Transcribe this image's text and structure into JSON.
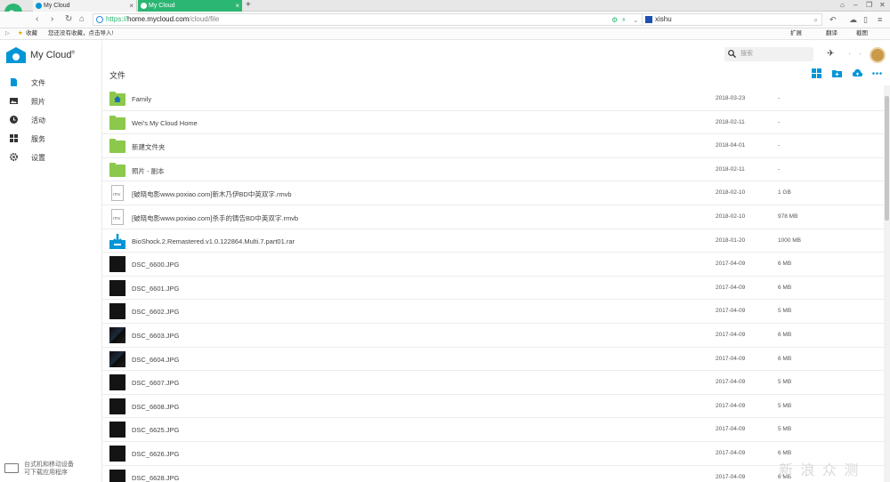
{
  "browser": {
    "tabs": [
      {
        "label": "My Cloud",
        "close": "×"
      },
      {
        "label": "My Cloud",
        "close": "×"
      }
    ],
    "new_tab": "+",
    "url": {
      "scheme": "https://",
      "host": "home.mycloud.com",
      "path": "/cloud/file"
    },
    "search_value": "xishu",
    "favorites": {
      "label": "收藏",
      "hint": "您还没有收藏，点击导入!",
      "ext": "扩展",
      "trans": "翻译",
      "shot": "截图"
    }
  },
  "app": {
    "title": "My Cloud",
    "title_mark": "®",
    "search_placeholder": "搜索",
    "sidebar": [
      {
        "label": "文件",
        "icon": "file-icon"
      },
      {
        "label": "照片",
        "icon": "photo-icon"
      },
      {
        "label": "活动",
        "icon": "clock-icon"
      },
      {
        "label": "服务",
        "icon": "grid-icon"
      },
      {
        "label": "设置",
        "icon": "gear-icon"
      }
    ],
    "device_note": [
      "台式机和移动设备",
      "可下载应用程序"
    ],
    "main_title": "文件",
    "colors": {
      "accent": "#0096d6",
      "folder": "#8cc84b",
      "tab_active": "#2bb673"
    }
  },
  "files": [
    {
      "name": "Family",
      "date": "2018-03-23",
      "size": "-",
      "kind": "shared-folder"
    },
    {
      "name": "Wei's My Cloud Home",
      "date": "2018-02-11",
      "size": "-",
      "kind": "folder"
    },
    {
      "name": "新建文件夹",
      "date": "2018-04-01",
      "size": "-",
      "kind": "folder"
    },
    {
      "name": "照片 - 副本",
      "date": "2018-02-11",
      "size": "-",
      "kind": "folder"
    },
    {
      "name": "[破晓电影www.poxiao.com]新木乃伊BD中英双字.rmvb",
      "date": "2018-02-10",
      "size": "1 GB",
      "kind": "video"
    },
    {
      "name": "[破晓电影www.poxiao.com]杀手的铸告BD中英双字.rmvb",
      "date": "2018-02-10",
      "size": "978 MB",
      "kind": "video"
    },
    {
      "name": "BioShock.2.Remastered.v1.0.122864.Multi.7.part01.rar",
      "date": "2018-01-20",
      "size": "1000 MB",
      "kind": "archive"
    },
    {
      "name": "DSC_6600.JPG",
      "date": "2017-04-09",
      "size": "6 MB",
      "kind": "photo"
    },
    {
      "name": "DSC_6601.JPG",
      "date": "2017-04-09",
      "size": "6 MB",
      "kind": "photo"
    },
    {
      "name": "DSC_6602.JPG",
      "date": "2017-04-09",
      "size": "5 MB",
      "kind": "photo"
    },
    {
      "name": "DSC_6603.JPG",
      "date": "2017-04-09",
      "size": "6 MB",
      "kind": "photo-b"
    },
    {
      "name": "DSC_6604.JPG",
      "date": "2017-04-09",
      "size": "6 MB",
      "kind": "photo-b"
    },
    {
      "name": "DSC_6607.JPG",
      "date": "2017-04-09",
      "size": "5 MB",
      "kind": "photo"
    },
    {
      "name": "DSC_6608.JPG",
      "date": "2017-04-09",
      "size": "5 MB",
      "kind": "photo"
    },
    {
      "name": "DSC_6625.JPG",
      "date": "2017-04-09",
      "size": "5 MB",
      "kind": "photo"
    },
    {
      "name": "DSC_6626.JPG",
      "date": "2017-04-09",
      "size": "6 MB",
      "kind": "photo"
    },
    {
      "name": "DSC_6628.JPG",
      "date": "2017-04-09",
      "size": "6 MB",
      "kind": "photo"
    }
  ],
  "watermark": "新 浪 众 测"
}
